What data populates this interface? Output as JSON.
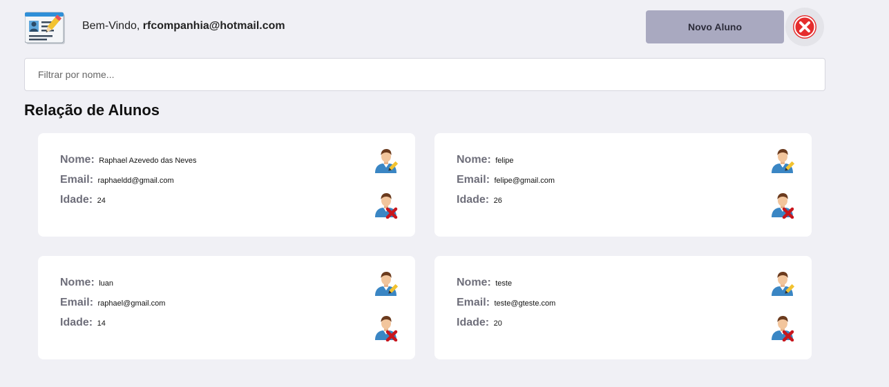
{
  "header": {
    "greeting": "Bem-Vindo,",
    "user_email": "rfcompanhia@hotmail.com",
    "new_button_label": "Novo Aluno"
  },
  "search": {
    "placeholder": "Filtrar por nome..."
  },
  "section_title": "Relação de Alunos",
  "labels": {
    "name": "Nome:",
    "email": "Email:",
    "age": "Idade:"
  },
  "students": [
    {
      "name": "Raphael Azevedo das Neves",
      "email": "raphaeldd@gmail.com",
      "age": "24"
    },
    {
      "name": "felipe",
      "email": "felipe@gmail.com",
      "age": "26"
    },
    {
      "name": "luan",
      "email": "raphael@gmail.com",
      "age": "14"
    },
    {
      "name": "teste",
      "email": "teste@gteste.com",
      "age": "20"
    }
  ],
  "icons": {
    "logo": "student-card-icon",
    "logout": "close-circle-icon",
    "edit": "user-edit-icon",
    "delete": "user-delete-icon"
  },
  "colors": {
    "background": "#f0f0f5",
    "button": "#a9a9c0",
    "card": "#ffffff",
    "label": "#6e6e7a",
    "logout_red": "#e52d2d"
  }
}
